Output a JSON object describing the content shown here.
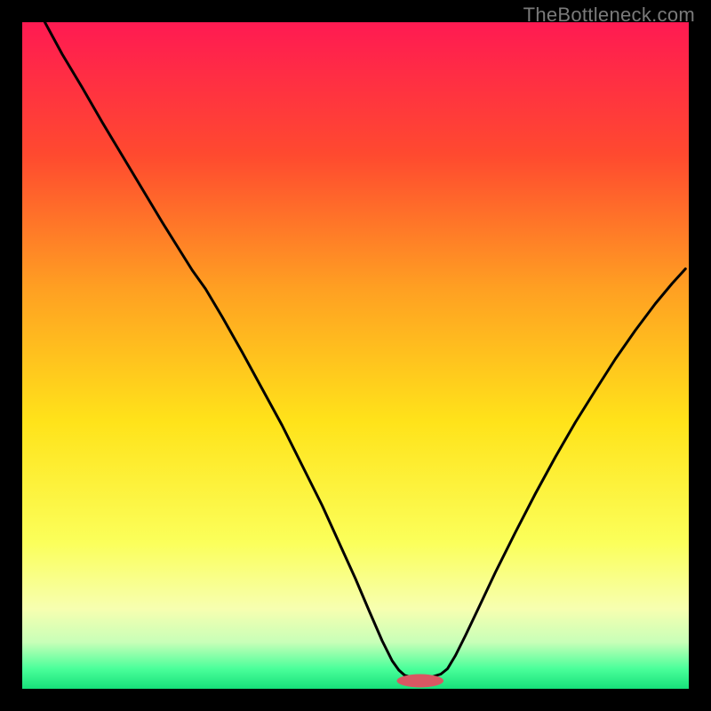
{
  "watermark": "TheBottleneck.com",
  "chart_data": {
    "type": "line",
    "title": "",
    "xlabel": "",
    "ylabel": "",
    "xlim": [
      0,
      1
    ],
    "ylim": [
      0,
      1
    ],
    "background": {
      "gradient_stops": [
        {
          "offset": 0.0,
          "color": "#ff1a52"
        },
        {
          "offset": 0.2,
          "color": "#ff4a2f"
        },
        {
          "offset": 0.4,
          "color": "#ffa022"
        },
        {
          "offset": 0.6,
          "color": "#ffe31a"
        },
        {
          "offset": 0.78,
          "color": "#fbff5a"
        },
        {
          "offset": 0.88,
          "color": "#f7ffb0"
        },
        {
          "offset": 0.93,
          "color": "#c8ffb8"
        },
        {
          "offset": 0.97,
          "color": "#4aff9a"
        },
        {
          "offset": 1.0,
          "color": "#17e07a"
        }
      ]
    },
    "curve": {
      "stroke": "#000000",
      "stroke_width": 3,
      "points": [
        {
          "x": 0.034,
          "y": 1.0
        },
        {
          "x": 0.06,
          "y": 0.952
        },
        {
          "x": 0.09,
          "y": 0.902
        },
        {
          "x": 0.12,
          "y": 0.85
        },
        {
          "x": 0.15,
          "y": 0.8
        },
        {
          "x": 0.18,
          "y": 0.75
        },
        {
          "x": 0.21,
          "y": 0.7
        },
        {
          "x": 0.235,
          "y": 0.66
        },
        {
          "x": 0.255,
          "y": 0.628
        },
        {
          "x": 0.275,
          "y": 0.6
        },
        {
          "x": 0.3,
          "y": 0.558
        },
        {
          "x": 0.33,
          "y": 0.505
        },
        {
          "x": 0.36,
          "y": 0.45
        },
        {
          "x": 0.39,
          "y": 0.395
        },
        {
          "x": 0.42,
          "y": 0.335
        },
        {
          "x": 0.45,
          "y": 0.275
        },
        {
          "x": 0.475,
          "y": 0.22
        },
        {
          "x": 0.5,
          "y": 0.165
        },
        {
          "x": 0.52,
          "y": 0.118
        },
        {
          "x": 0.54,
          "y": 0.072
        },
        {
          "x": 0.555,
          "y": 0.042
        },
        {
          "x": 0.565,
          "y": 0.028
        },
        {
          "x": 0.574,
          "y": 0.02
        },
        {
          "x": 0.585,
          "y": 0.017
        },
        {
          "x": 0.6,
          "y": 0.017
        },
        {
          "x": 0.615,
          "y": 0.018
        },
        {
          "x": 0.628,
          "y": 0.022
        },
        {
          "x": 0.638,
          "y": 0.03
        },
        {
          "x": 0.65,
          "y": 0.05
        },
        {
          "x": 0.665,
          "y": 0.08
        },
        {
          "x": 0.685,
          "y": 0.122
        },
        {
          "x": 0.71,
          "y": 0.175
        },
        {
          "x": 0.74,
          "y": 0.235
        },
        {
          "x": 0.77,
          "y": 0.293
        },
        {
          "x": 0.8,
          "y": 0.348
        },
        {
          "x": 0.83,
          "y": 0.4
        },
        {
          "x": 0.86,
          "y": 0.448
        },
        {
          "x": 0.89,
          "y": 0.495
        },
        {
          "x": 0.92,
          "y": 0.538
        },
        {
          "x": 0.95,
          "y": 0.578
        },
        {
          "x": 0.975,
          "y": 0.608
        },
        {
          "x": 0.995,
          "y": 0.63
        }
      ]
    },
    "marker": {
      "fill": "#d95763",
      "cx": 0.597,
      "cy": 0.012,
      "rx": 0.035,
      "ry": 0.01
    },
    "frame": {
      "inner_x": 25,
      "inner_y": 25,
      "inner_w": 750,
      "inner_h": 750,
      "stroke": "#000000",
      "stroke_width": 25
    }
  }
}
